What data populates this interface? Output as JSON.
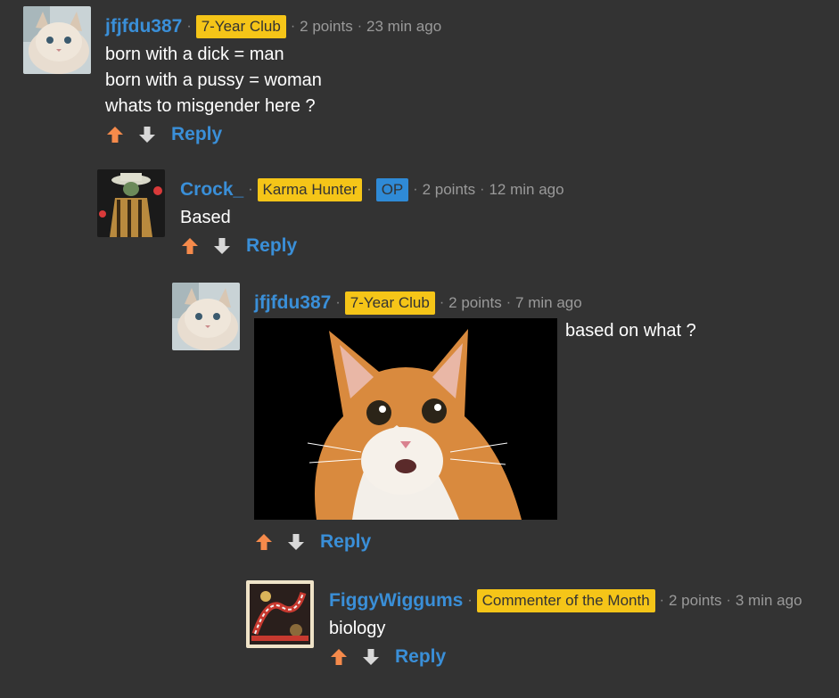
{
  "comments": [
    {
      "username": "jfjfdu387",
      "badge": "7-Year Club",
      "op": "",
      "points": "2 points",
      "time": "23 min ago",
      "text": [
        "born with a dick = man",
        "born with a pussy = woman",
        "whats to misgender here ?"
      ],
      "reply_label": "Reply",
      "avatar_icon": "cat-avatar"
    },
    {
      "username": "Crock_",
      "badge": "Karma Hunter",
      "op": "OP",
      "points": "2 points",
      "time": "12 min ago",
      "text": [
        "Based"
      ],
      "reply_label": "Reply",
      "avatar_icon": "gangster-avatar"
    },
    {
      "username": "jfjfdu387",
      "badge": "7-Year Club",
      "op": "",
      "points": "2 points",
      "time": "7 min ago",
      "text": [
        "based on what ?"
      ],
      "reply_label": "Reply",
      "avatar_icon": "cat-avatar",
      "image": "surprised-cat-photo"
    },
    {
      "username": "FiggyWiggums",
      "badge": "Commenter of the Month",
      "op": "",
      "points": "2 points",
      "time": "3 min ago",
      "text": [
        "biology"
      ],
      "reply_label": "Reply",
      "avatar_icon": "pattern-avatar"
    }
  ],
  "colors": {
    "background": "#333333",
    "username": "#3a8fd8",
    "badge": "#f5c518",
    "op_badge": "#2f8ad6",
    "upvote": "#f58a4b",
    "downvote": "#d8d8d8"
  }
}
